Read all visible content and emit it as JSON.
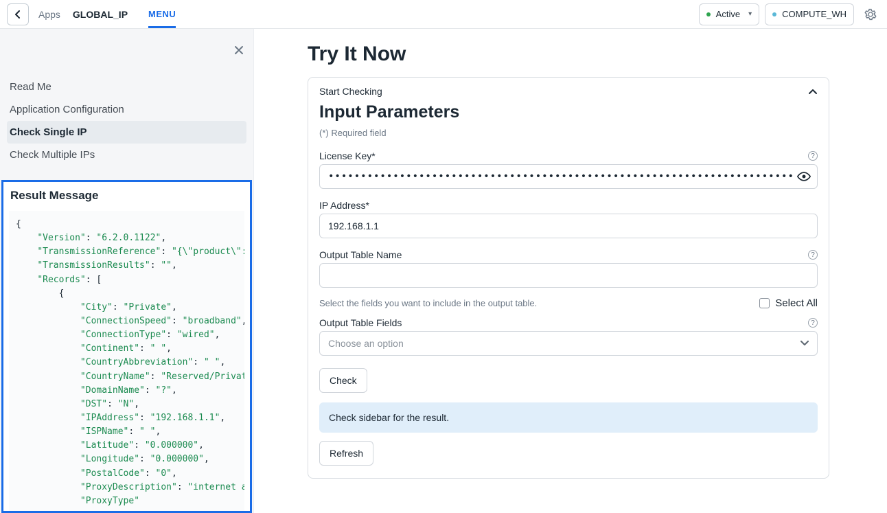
{
  "topbar": {
    "breadcrumb_apps": "Apps",
    "breadcrumb_title": "GLOBAL_IP",
    "menu_tab": "MENU",
    "status_label": "Active",
    "warehouse_label": "COMPUTE_WH"
  },
  "sidebar": {
    "nav": {
      "readme": "Read Me",
      "app_config": "Application Configuration",
      "check_single": "Check Single IP",
      "check_multiple": "Check Multiple IPs"
    },
    "result_title": "Result Message",
    "json": {
      "l0": "{",
      "k_version": "\"Version\"",
      "v_version": "\"6.2.0.1122\"",
      "k_txref": "\"TransmissionReference\"",
      "v_txref": "\"{\\\"product\\\":\\\"S",
      "k_txres": "\"TransmissionResults\"",
      "v_txres": "\"\"",
      "k_records": "\"Records\"",
      "k_city": "\"City\"",
      "v_city": "\"Private\"",
      "k_connspeed": "\"ConnectionSpeed\"",
      "v_connspeed": "\"broadband\"",
      "k_conntype": "\"ConnectionType\"",
      "v_conntype": "\"wired\"",
      "k_continent": "\"Continent\"",
      "v_continent": "\" \"",
      "k_cabbr": "\"CountryAbbreviation\"",
      "v_cabbr": "\" \"",
      "k_cname": "\"CountryName\"",
      "v_cname": "\"Reserved/Private\"",
      "k_domain": "\"DomainName\"",
      "v_domain": "\"?\"",
      "k_dst": "\"DST\"",
      "v_dst": "\"N\"",
      "k_ip": "\"IPAddress\"",
      "v_ip": "\"192.168.1.1\"",
      "k_isp": "\"ISPName\"",
      "v_isp": "\" \"",
      "k_lat": "\"Latitude\"",
      "v_lat": "\"0.000000\"",
      "k_lon": "\"Longitude\"",
      "v_lon": "\"0.000000\"",
      "k_postal": "\"PostalCode\"",
      "v_postal": "\"0\"",
      "k_proxydesc": "\"ProxyDescription\"",
      "v_proxydesc": "\"internet assi",
      "k_proxytype_cut": "\"ProxyType\""
    }
  },
  "main": {
    "page_title": "Try It Now",
    "panel_label": "Start Checking",
    "section_title": "Input Parameters",
    "required_note": "(*) Required field",
    "fields": {
      "license_label": "License Key*",
      "license_value": "•••••••••••••••••••••••••••••••••••••••••••••••••••••••••••••••••••••••••••••••",
      "ip_label": "IP Address*",
      "ip_value": "192.168.1.1",
      "out_name_label": "Output Table Name",
      "out_name_value": "",
      "fields_hint": "Select the fields you want to include in the output table.",
      "select_all_label": "Select All",
      "out_fields_label": "Output Table Fields",
      "out_fields_placeholder": "Choose an option"
    },
    "check_btn": "Check",
    "info_banner": "Check sidebar for the result.",
    "refresh_btn": "Refresh"
  }
}
